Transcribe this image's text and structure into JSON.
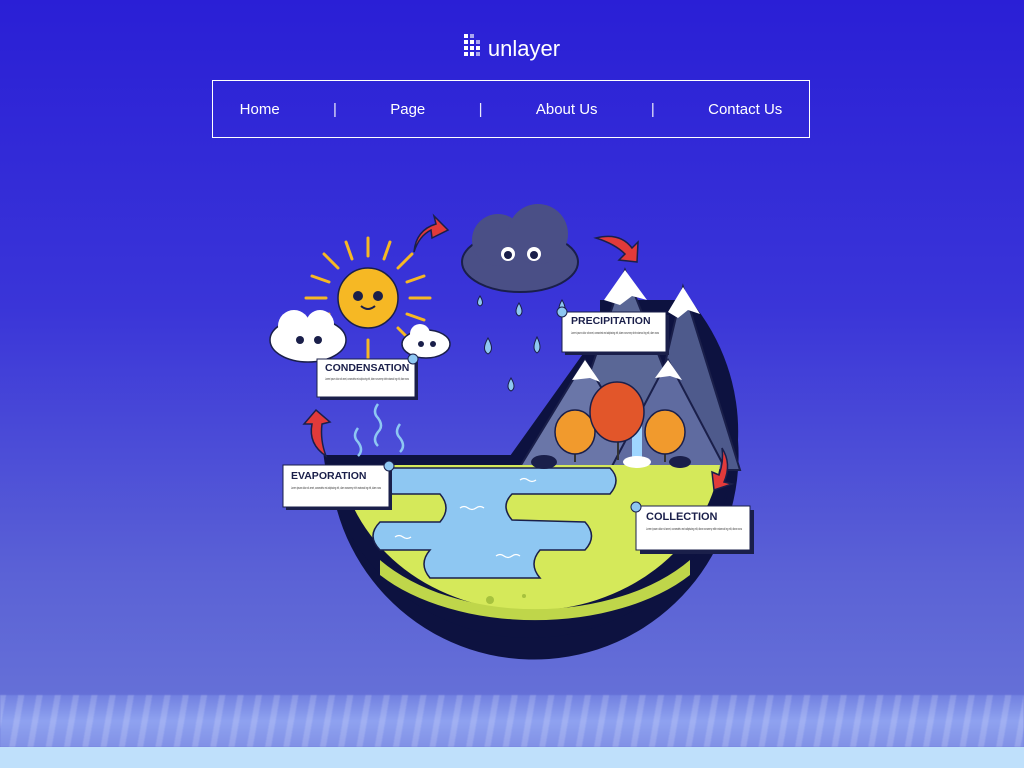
{
  "brand": {
    "name": "unlayer"
  },
  "nav": {
    "items": [
      "Home",
      "Page",
      "About Us",
      "Contact Us"
    ],
    "separator": "|"
  },
  "diagram": {
    "labels": {
      "condensation": "CONDENSATION",
      "precipitation": "PRECIPITATION",
      "evaporation": "EVAPORATION",
      "collection": "COLLECTION"
    },
    "lorem": "Lorem ipsum dolor sit amet, consectetu est adipiscing elit, diam nonummy nibh euismod ing elit, diam nonu"
  },
  "colors": {
    "background_top": "#2a1fd6",
    "background_bottom": "#6b78d8",
    "earth_green": "#d5e95a",
    "water_blue": "#8ec7f2",
    "cloud_dark": "#4a4f86",
    "sun": "#f6b824",
    "arrow_red": "#e23a3a"
  }
}
